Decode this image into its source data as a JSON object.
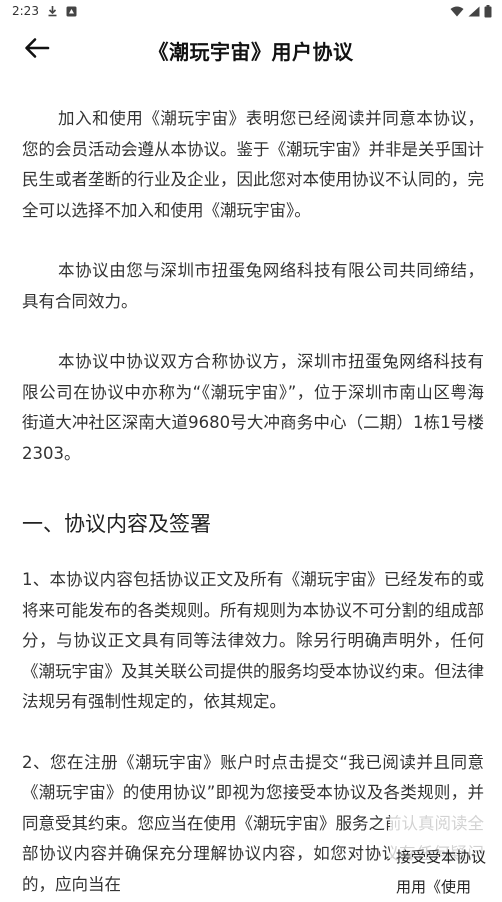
{
  "status_bar": {
    "time": "2:23",
    "icons": [
      "download-icon",
      "notification-app-icon",
      "wifi-icon",
      "signal-icon",
      "battery-icon"
    ]
  },
  "header": {
    "title": "《潮玩宇宙》用户协议",
    "back_icon": "arrow-left-icon"
  },
  "content": {
    "paragraphs": [
      "加入和使用《潮玩宇宙》表明您已经阅读并同意本协议，您的会员活动会遵从本协议。鉴于《潮玩宇宙》并非是关乎国计民生或者垄断的行业及企业，因此您对本使用协议不认同的，完全可以选择不加入和使用《潮玩宇宙》。",
      "本协议由您与深圳市扭蛋兔网络科技有限公司共同缔结，具有合同效力。",
      "本协议中协议双方合称协议方，深圳市扭蛋兔网络科技有限公司在协议中亦称为“《潮玩宇宙》”，位于深圳市南山区粤海街道大冲社区深南大道9680号大冲商务中心（二期）1栋1号楼2303。"
    ],
    "section_heading": "一、协议内容及签署",
    "section_items": [
      "1、本协议内容包括协议正文及所有《潮玩宇宙》已经发布的或将来可能发布的各类规则。所有规则为本协议不可分割的组成部分，与协议正文具有同等法律效力。除另行明确声明外，任何《潮玩宇宙》及其关联公司提供的服务均受本协议约束。但法律法规另有强制性规定的，依其规定。",
      "2、您在注册《潮玩宇宙》账户时点击提交“我已阅读并且同意《潮玩宇宙》的使用协议”即视为您接受本协议及各类规则，并同意受其约束。您应当在使用《潮玩宇宙》服务之前认真阅读全部协议内容并确保充分理解协议内容，如您对协议有任何疑问的，应向当在"
    ]
  },
  "overlay": {
    "line1": "接受受本协议",
    "line2": "用用《使用"
  },
  "colors": {
    "text": "#333333",
    "title": "#111111",
    "background": "#ffffff"
  }
}
